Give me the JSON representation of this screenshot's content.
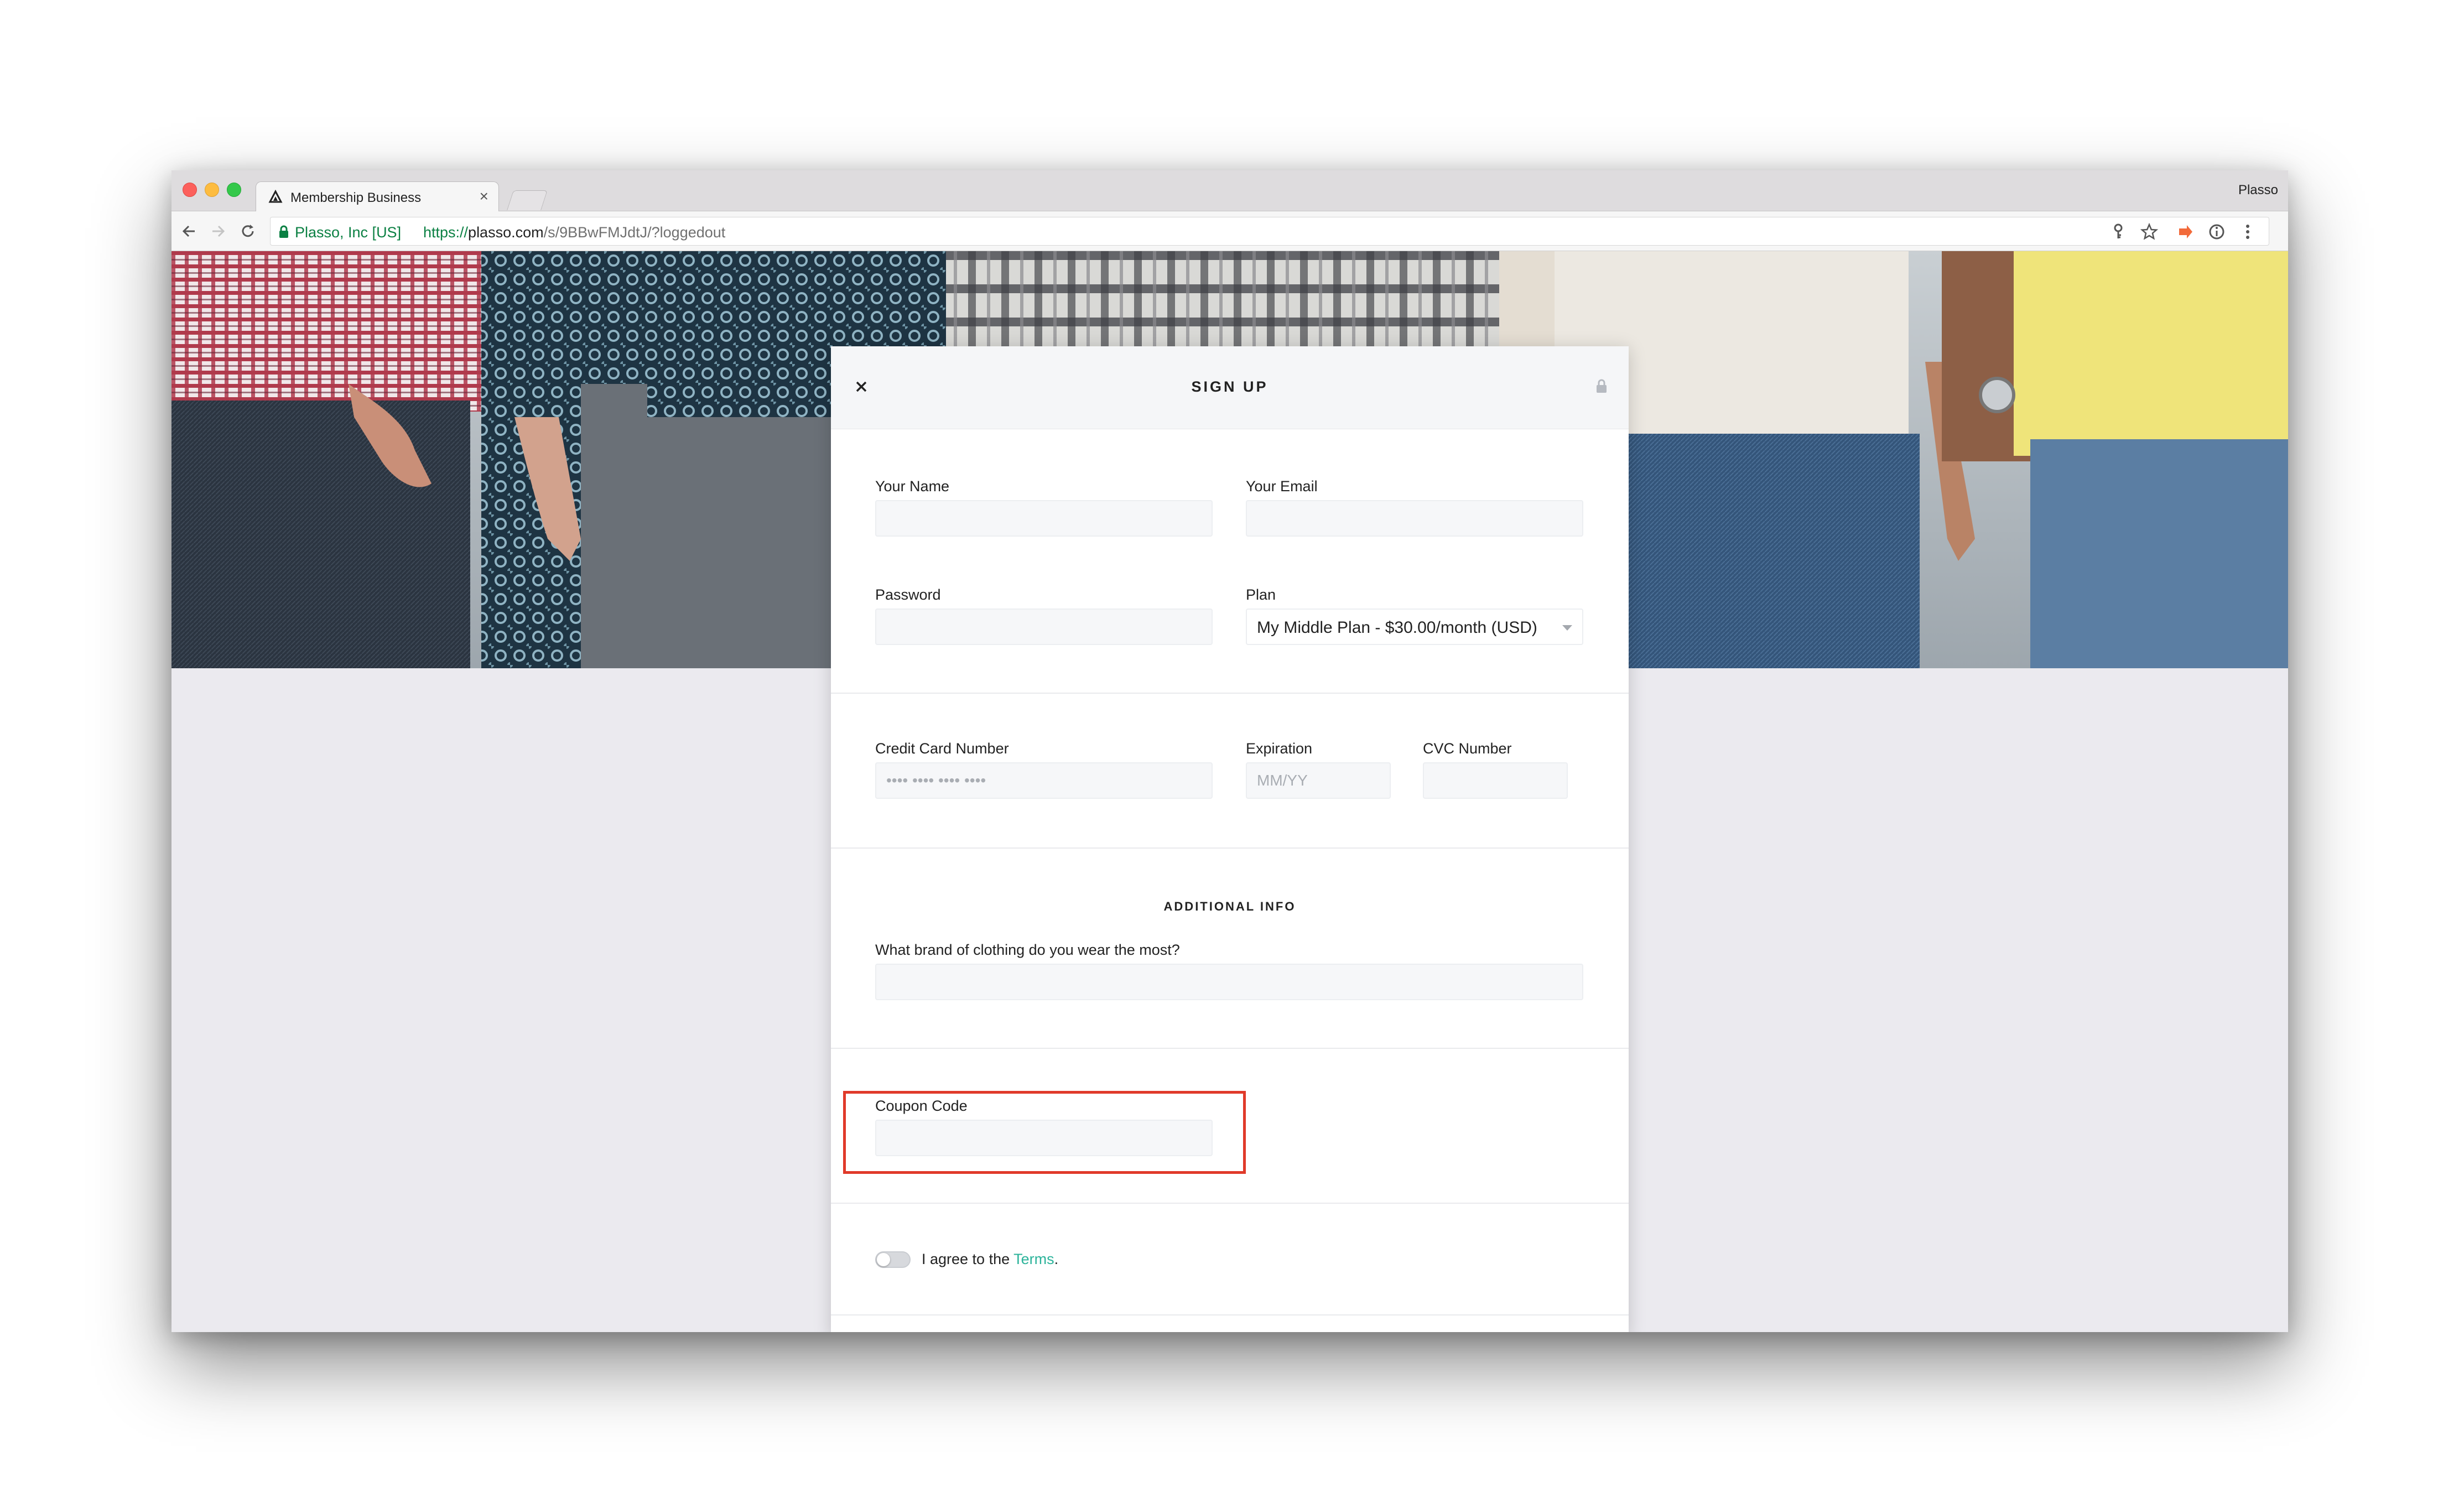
{
  "browser": {
    "tab_title": "Membership Business",
    "tab_close": "×",
    "profile_name": "Plasso",
    "secure_label": "Plasso, Inc [US]",
    "url_scheme": "https://",
    "url_host": "plasso.com",
    "url_path": "/s/9BBwFMJdtJ/?loggedout"
  },
  "modal": {
    "title": "SIGN UP",
    "close_symbol": "✕",
    "fields": {
      "name_label": "Your Name",
      "email_label": "Your Email",
      "password_label": "Password",
      "plan_label": "Plan",
      "plan_value": "My Middle Plan - $30.00/month (USD)",
      "card_label": "Credit Card Number",
      "card_placeholder": "•••• •••• •••• ••••",
      "expiration_label": "Expiration",
      "expiration_placeholder": "MM/YY",
      "cvc_label": "CVC Number"
    },
    "additional_info": {
      "title": "ADDITIONAL INFO",
      "question_label": "What brand of clothing do you wear the most?"
    },
    "coupon": {
      "label": "Coupon Code"
    },
    "terms": {
      "prefix": "I agree to the ",
      "link": "Terms",
      "suffix": ".",
      "toggle_on": false
    }
  },
  "colors": {
    "highlight": "#e03a2a",
    "link": "#2bb39a",
    "secure_green": "#0b8043"
  },
  "icons": [
    "back-icon",
    "forward-icon",
    "reload-icon",
    "lock-icon",
    "key-icon",
    "star-icon",
    "extension-icon",
    "info-icon",
    "menu-icon",
    "close-icon",
    "chevron-down-icon"
  ]
}
